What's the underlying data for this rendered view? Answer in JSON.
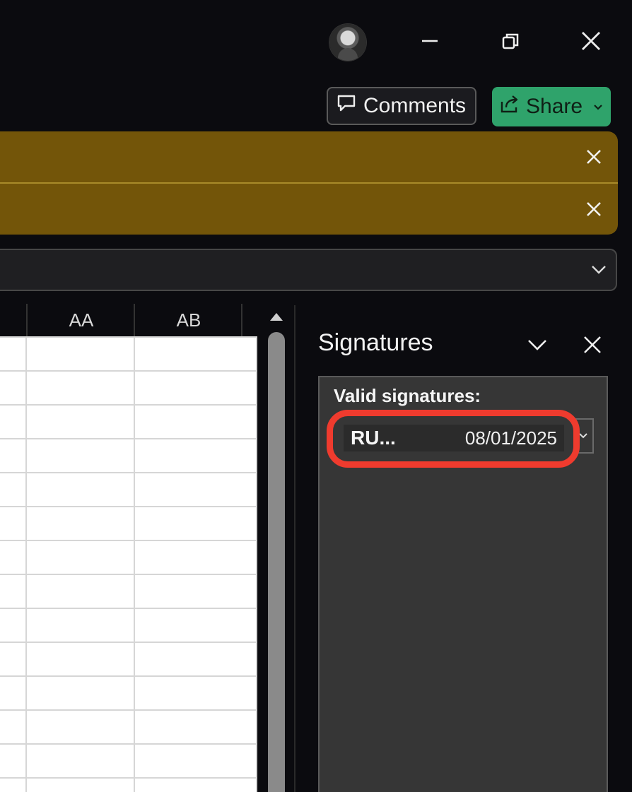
{
  "titlebar": {
    "minimize_icon": "minimize-icon",
    "restore_icon": "restore-icon",
    "close_icon": "close-icon"
  },
  "toolbar": {
    "comments_label": "Comments",
    "share_label": "Share"
  },
  "grid": {
    "columns": [
      "AA",
      "AB"
    ]
  },
  "signatures_pane": {
    "title": "Signatures",
    "section_label": "Valid signatures:",
    "items": [
      {
        "signer": "RU...",
        "date": "08/01/2025"
      }
    ]
  },
  "colors": {
    "banner": "#735509",
    "share": "#2fa36b",
    "highlight": "#ef3b2e"
  }
}
